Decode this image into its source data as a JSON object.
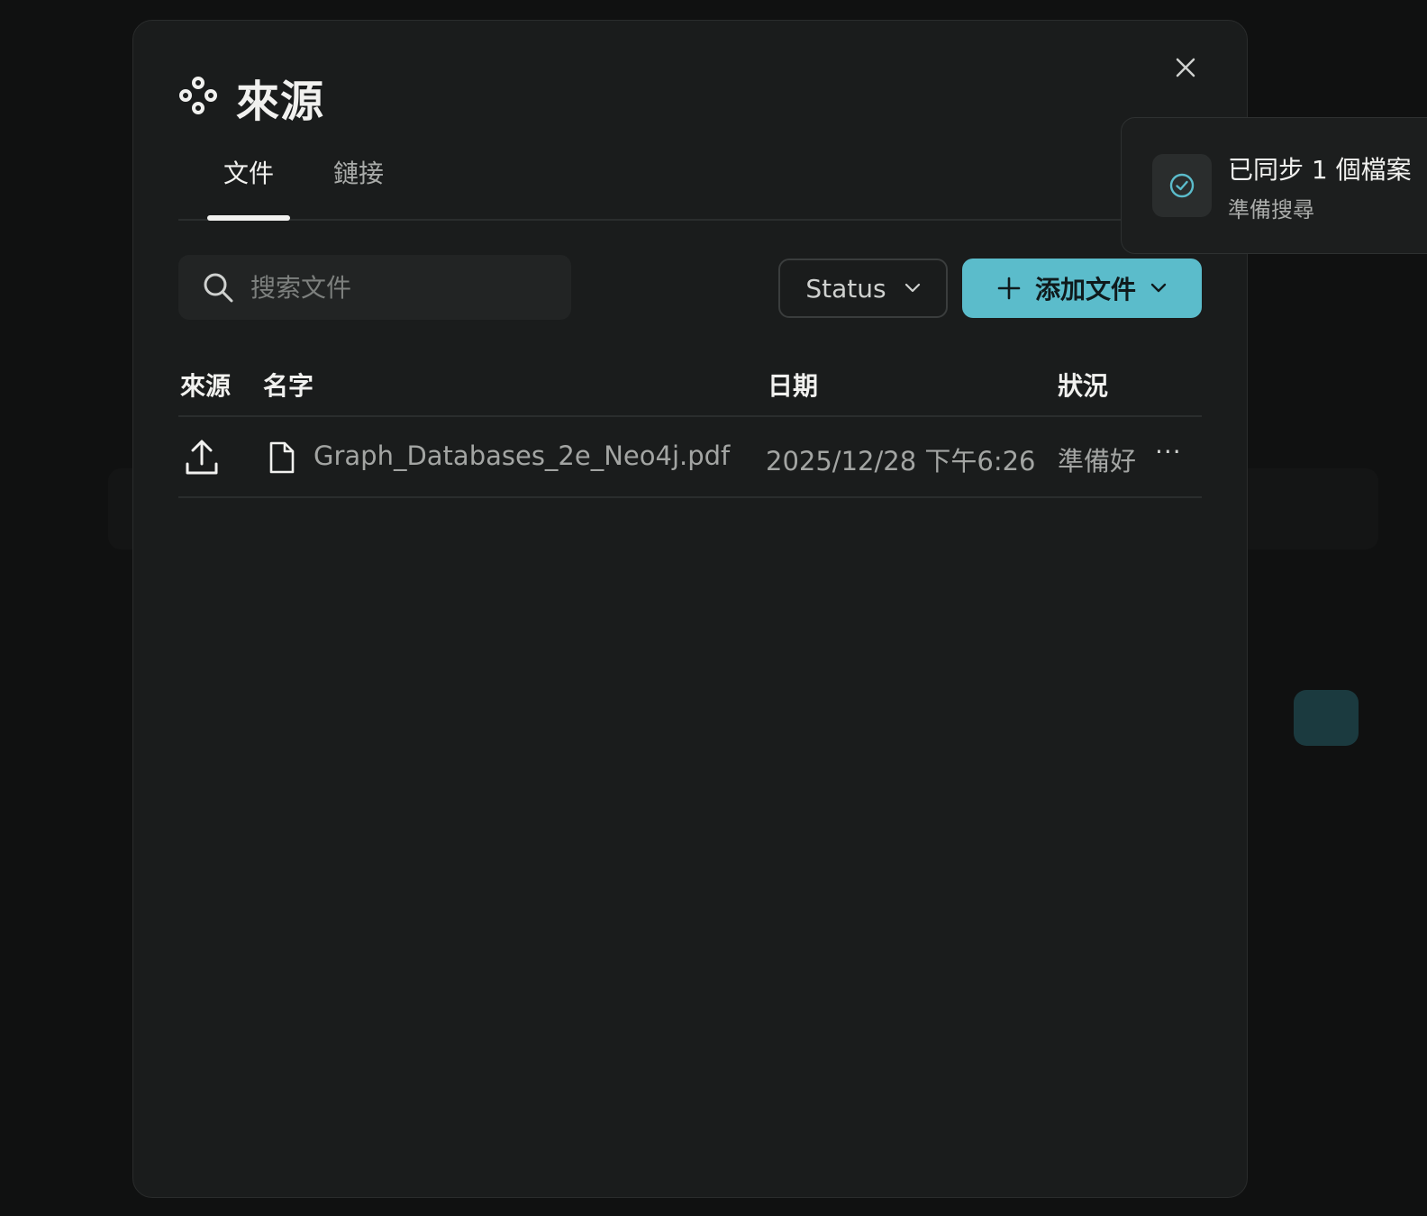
{
  "dialog": {
    "title": "來源",
    "close_label": "close",
    "tabs": [
      {
        "label": "文件",
        "active": true
      },
      {
        "label": "鏈接",
        "active": false
      }
    ]
  },
  "toolbar": {
    "search_placeholder": "搜索文件",
    "status_filter_label": "Status",
    "add_button_label": "添加文件"
  },
  "table": {
    "columns": [
      "來源",
      "名字",
      "日期",
      "狀況"
    ],
    "rows": [
      {
        "source_icon": "upload-icon",
        "file_icon": "file-icon",
        "name": "Graph_Databases_2e_Neo4j.pdf",
        "date": "2025/12/28 下午6:26",
        "status": "準備好",
        "menu": "···"
      }
    ]
  },
  "toast": {
    "title": "已同步 1 個檔案",
    "subtitle": "準備搜尋",
    "icon": "check-circle-icon"
  },
  "colors": {
    "accent": "#5bbccb",
    "background": "#1a1c1c",
    "text": "#f1f1ef",
    "muted_text": "#a3a5a3"
  }
}
